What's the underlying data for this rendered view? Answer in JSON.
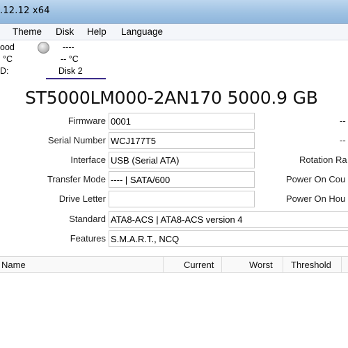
{
  "window": {
    "title": ".12.12 x64"
  },
  "menu": {
    "items": [
      "Theme",
      "Disk",
      "Help",
      "Language"
    ]
  },
  "status": {
    "disk1": {
      "health": "ood",
      "temperature": "°C",
      "label": "D:"
    },
    "disk2": {
      "health": "----",
      "temperature": "-- °C",
      "label": "Disk 2"
    }
  },
  "drive": {
    "model": "ST5000LM000-2AN170 5000.9 GB",
    "fields": {
      "firmware": {
        "label": "Firmware",
        "value": "0001"
      },
      "serial": {
        "label": "Serial Number",
        "value": "WCJ177T5"
      },
      "interface": {
        "label": "Interface",
        "value": "USB (Serial ATA)"
      },
      "transfer": {
        "label": "Transfer Mode",
        "value": "---- | SATA/600"
      },
      "letter": {
        "label": "Drive Letter",
        "value": ""
      },
      "standard": {
        "label": "Standard",
        "value": "ATA8-ACS | ATA8-ACS version 4"
      },
      "features": {
        "label": "Features",
        "value": "S.M.A.R.T., NCQ"
      }
    },
    "right": {
      "row1": "--",
      "row2": "--",
      "rotation": "Rotation Ra",
      "power_count": "Power On Cou",
      "power_hours": "Power On Hou"
    }
  },
  "smart_table": {
    "columns": [
      "Name",
      "Current",
      "Worst",
      "Threshold"
    ]
  }
}
